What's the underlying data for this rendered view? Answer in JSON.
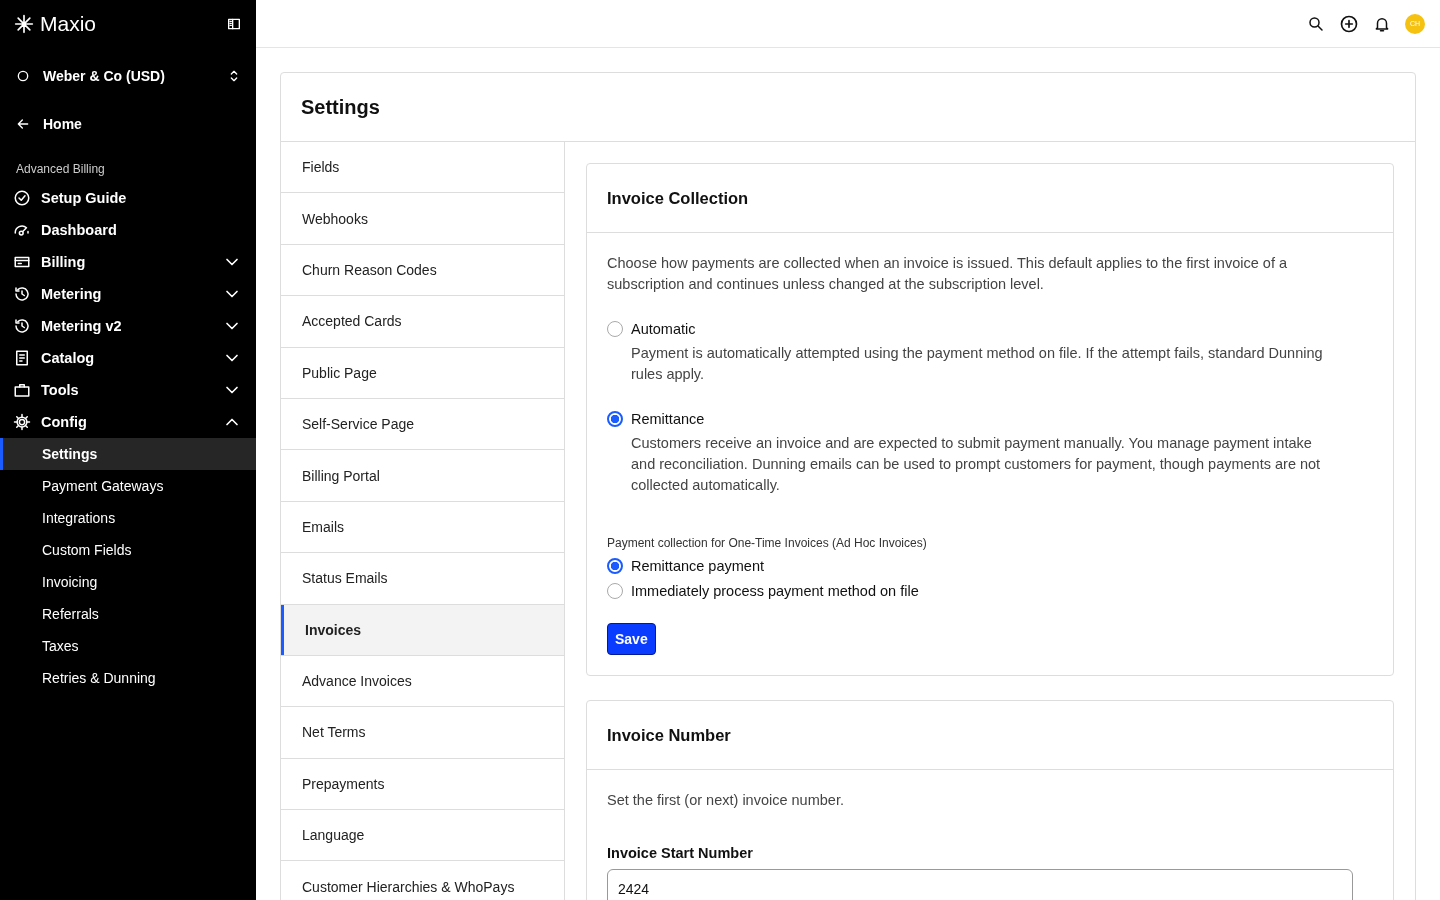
{
  "brand": {
    "name": "Maxio"
  },
  "account": {
    "name": "Weber & Co (USD)"
  },
  "home": {
    "label": "Home"
  },
  "section_label": "Advanced Billing",
  "nav": [
    {
      "label": "Setup Guide"
    },
    {
      "label": "Dashboard"
    },
    {
      "label": "Billing",
      "expanded": false
    },
    {
      "label": "Metering",
      "expanded": false
    },
    {
      "label": "Metering v2",
      "expanded": false
    },
    {
      "label": "Catalog",
      "expanded": false
    },
    {
      "label": "Tools",
      "expanded": false
    },
    {
      "label": "Config",
      "expanded": true,
      "children": [
        {
          "label": "Settings",
          "selected": true
        },
        {
          "label": "Payment Gateways",
          "selected": false
        },
        {
          "label": "Integrations",
          "selected": false
        },
        {
          "label": "Custom Fields",
          "selected": false
        },
        {
          "label": "Invoicing",
          "selected": false
        },
        {
          "label": "Referrals",
          "selected": false
        },
        {
          "label": "Taxes",
          "selected": false
        },
        {
          "label": "Retries & Dunning",
          "selected": false
        }
      ]
    }
  ],
  "topbar": {
    "avatar": "CH"
  },
  "settings": {
    "title": "Settings",
    "menu": [
      {
        "label": "Fields",
        "selected": false
      },
      {
        "label": "Webhooks",
        "selected": false
      },
      {
        "label": "Churn Reason Codes",
        "selected": false
      },
      {
        "label": "Accepted Cards",
        "selected": false
      },
      {
        "label": "Public Page",
        "selected": false
      },
      {
        "label": "Self-Service Page",
        "selected": false
      },
      {
        "label": "Billing Portal",
        "selected": false
      },
      {
        "label": "Emails",
        "selected": false
      },
      {
        "label": "Status Emails",
        "selected": false
      },
      {
        "label": "Invoices",
        "selected": true
      },
      {
        "label": "Advance Invoices",
        "selected": false
      },
      {
        "label": "Net Terms",
        "selected": false
      },
      {
        "label": "Prepayments",
        "selected": false
      },
      {
        "label": "Language",
        "selected": false
      },
      {
        "label": "Customer Hierarchies & WhoPays",
        "selected": false
      }
    ],
    "invoice_collection": {
      "title": "Invoice Collection",
      "description": "Choose how payments are collected when an invoice is issued. This default applies to the first invoice of a subscription and continues unless changed at the subscription level.",
      "options": [
        {
          "label": "Automatic",
          "description": "Payment is automatically attempted using the payment method on file. If the attempt fails, standard Dunning rules apply.",
          "selected": false
        },
        {
          "label": "Remittance",
          "description": "Customers receive an invoice and are expected to submit payment manually. You manage payment intake and reconciliation. Dunning emails can be used to prompt customers for payment, though payments are not collected automatically.",
          "selected": true
        }
      ],
      "one_time_label": "Payment collection for One-Time Invoices (Ad Hoc Invoices)",
      "one_time_options": [
        {
          "label": "Remittance payment",
          "selected": true
        },
        {
          "label": "Immediately process payment method on file",
          "selected": false
        }
      ],
      "save": "Save"
    },
    "invoice_number": {
      "title": "Invoice Number",
      "description": "Set the first (or next) invoice number.",
      "field_label": "Invoice Start Number",
      "value": "2424"
    }
  }
}
